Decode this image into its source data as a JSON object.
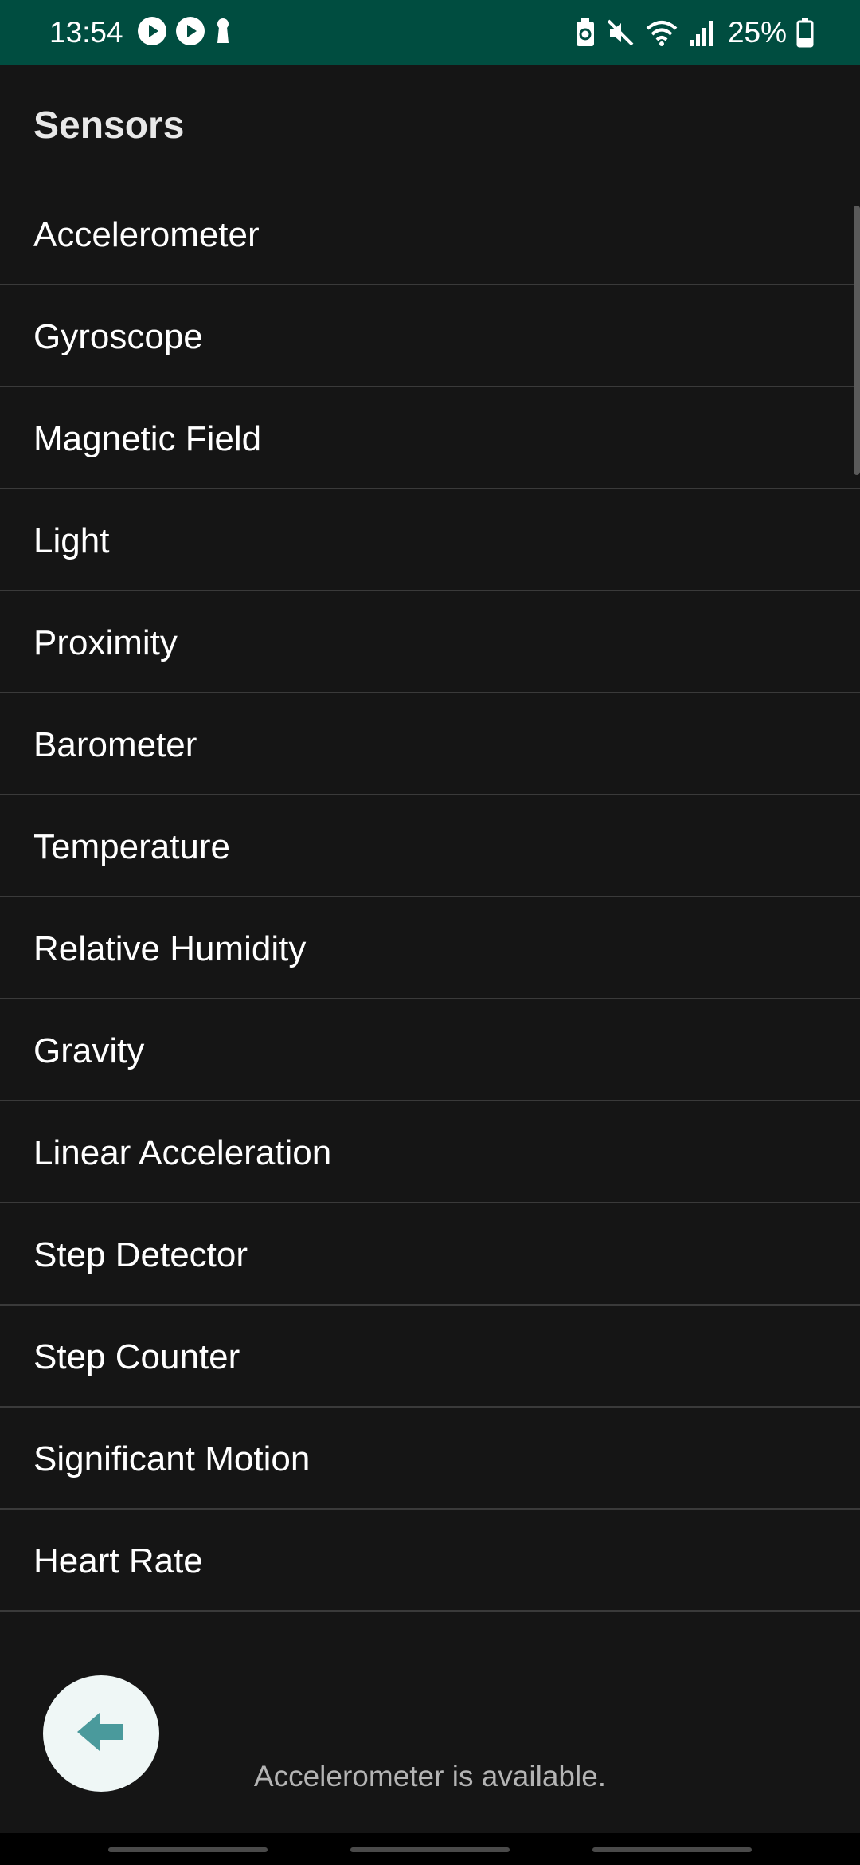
{
  "status_bar": {
    "time": "13:54",
    "battery": "25%",
    "background": "#004d40",
    "left_icons": [
      "play-circle-icon",
      "play-circle-icon",
      "keyhole-icon"
    ],
    "right_icons": [
      "battery-saver-icon",
      "mute-icon",
      "wifi-icon",
      "signal-icon",
      "battery-icon"
    ]
  },
  "page": {
    "title": "Sensors"
  },
  "sensors": [
    "Accelerometer",
    "Gyroscope",
    "Magnetic Field",
    "Light",
    "Proximity",
    "Barometer",
    "Temperature",
    "Relative Humidity",
    "Gravity",
    "Linear Acceleration",
    "Step Detector",
    "Step Counter",
    "Significant Motion",
    "Heart Rate"
  ],
  "fab": {
    "icon": "arrow-left-icon",
    "icon_color": "#4a9a9c"
  },
  "status_message": "Accelerometer is available."
}
